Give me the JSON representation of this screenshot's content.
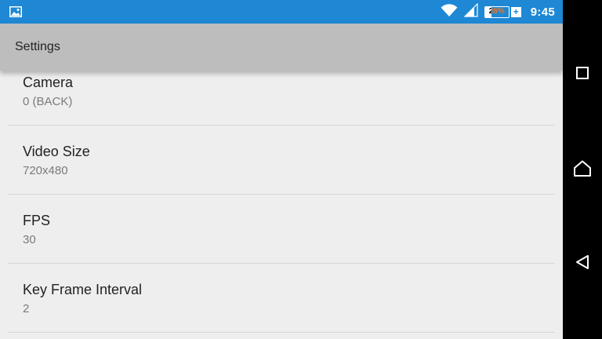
{
  "status_bar": {
    "time": "9:45",
    "battery_percent_label": "26%",
    "battery_level": 0.26,
    "battery_charging_symbol": "+",
    "icons": [
      "gallery-notification-icon",
      "wifi-icon",
      "cell-signal-icon",
      "battery-icon"
    ],
    "color": "#1e88d5"
  },
  "toolbar": {
    "title": "Settings",
    "color": "#bdbdbd"
  },
  "preferences": [
    {
      "title": "Camera",
      "summary": "0 (BACK)"
    },
    {
      "title": "Video Size",
      "summary": "720x480"
    },
    {
      "title": "FPS",
      "summary": "30"
    },
    {
      "title": "Key Frame Interval",
      "summary": "2"
    }
  ],
  "navigation_bar": {
    "buttons": [
      "recents-icon",
      "home-icon",
      "back-icon"
    ]
  }
}
